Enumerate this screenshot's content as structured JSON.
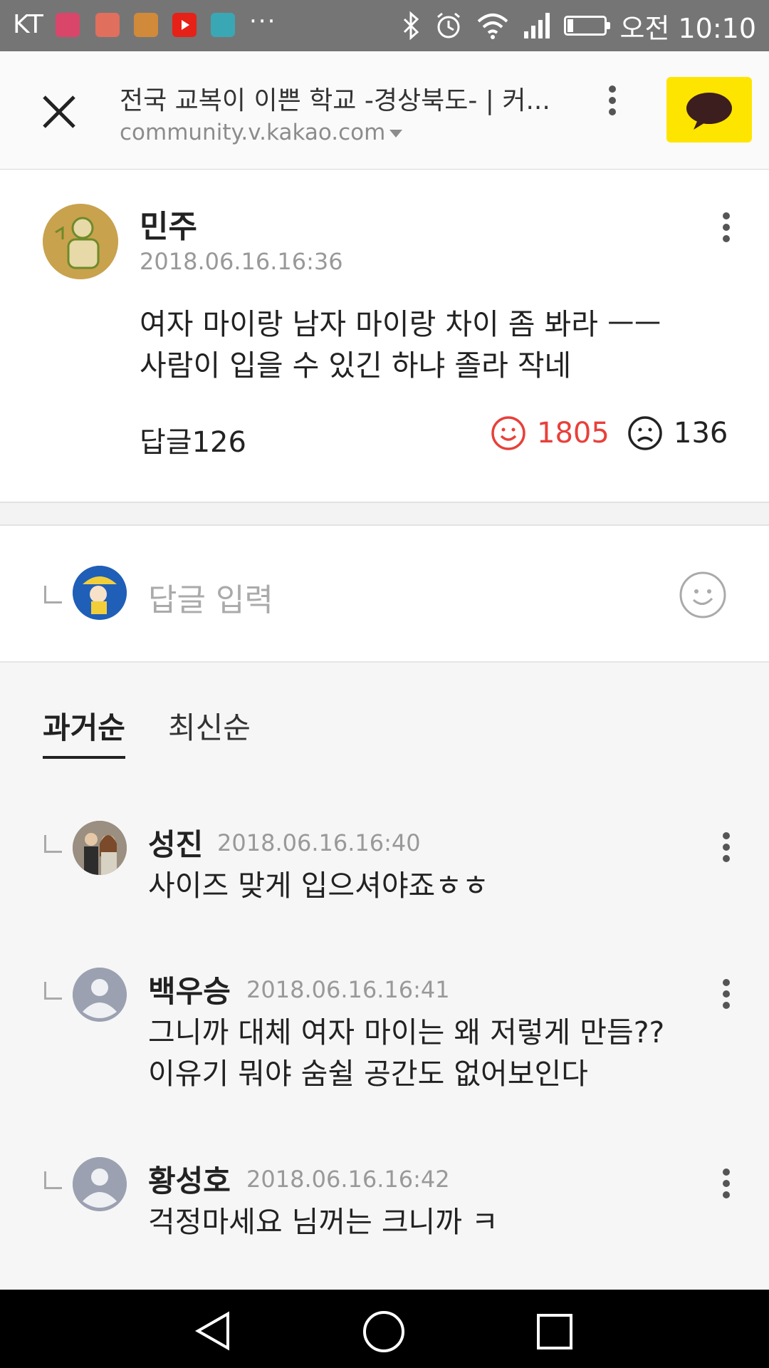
{
  "status_bar": {
    "carrier": "KT",
    "more": "···",
    "time": "오전 10:10",
    "icons": [
      "music-app-icon",
      "mail-app-icon",
      "clipboard-app-icon",
      "youtube-app-icon",
      "gallery-app-icon",
      "bluetooth-icon",
      "alarm-icon",
      "wifi-icon",
      "signal-icon",
      "battery-icon"
    ]
  },
  "browser": {
    "title": "전국 교복이 이쁜 학교 -경상북도- | 커...",
    "url": "community.v.kakao.com",
    "kakao_color": "#fee500"
  },
  "post": {
    "author": "민주",
    "time": "2018.06.16.16:36",
    "body_line1": "여자 마이랑 남자 마이랑 차이 좀 봐라 ㅡㅡ",
    "body_line2": "사람이 입을 수 있긴 하냐 졸라 작네",
    "replies_label": "답글126",
    "like_count": "1805",
    "dislike_count": "136",
    "like_color": "#e8403a"
  },
  "reply_input": {
    "placeholder": "답글 입력"
  },
  "sort": {
    "oldest": "과거순",
    "newest": "최신순"
  },
  "comments": [
    {
      "author": "성진",
      "time": "2018.06.16.16:40",
      "lines": [
        "사이즈 맞게 입으셔야죠ㅎㅎ"
      ]
    },
    {
      "author": "백우승",
      "time": "2018.06.16.16:41",
      "lines": [
        "그니까 대체 여자 마이는 왜 저렇게 만듬??",
        "이유기 뭐야 숨쉴 공간도 없어보인다"
      ]
    },
    {
      "author": "황성호",
      "time": "2018.06.16.16:42",
      "lines": [
        "걱정마세요 님꺼는 크니까 ㅋ"
      ]
    }
  ]
}
